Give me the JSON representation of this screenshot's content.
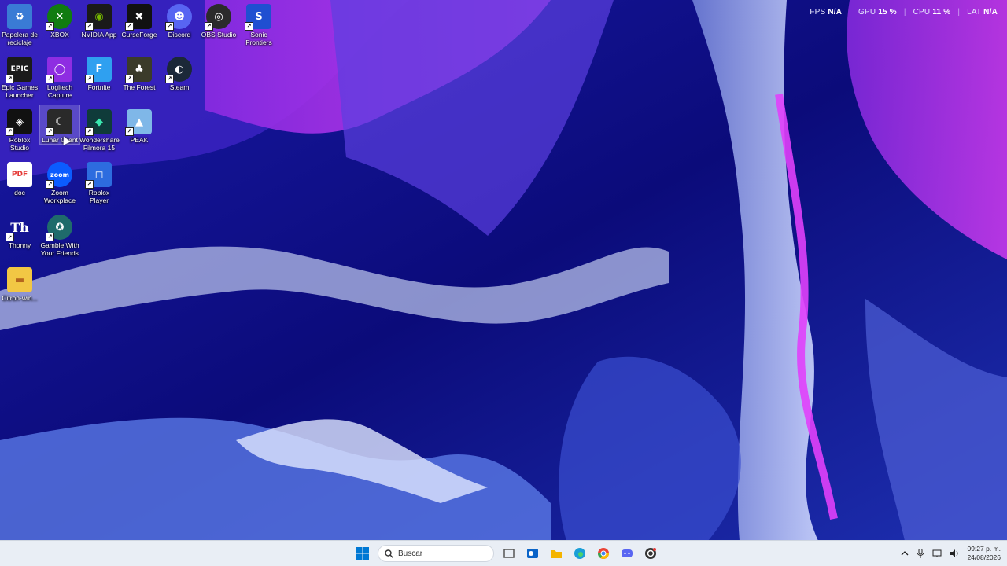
{
  "overlay": {
    "fps_label": "FPS",
    "fps_value": "N/A",
    "gpu_label": "GPU",
    "gpu_value": "15 %",
    "cpu_label": "CPU",
    "cpu_value": "11 %",
    "lat_label": "LAT",
    "lat_value": "N/A",
    "separator": "|"
  },
  "desktop": {
    "icons": [
      {
        "label": "Papelera de reciclaje",
        "icon": "recycle-bin-icon",
        "color": "#3a7bd5"
      },
      {
        "label": "XBOX",
        "icon": "xbox-icon",
        "color": "#107c10"
      },
      {
        "label": "NVIDIA App",
        "icon": "nvidia-icon",
        "color": "#1a1a1a"
      },
      {
        "label": "CurseForge",
        "icon": "curseforge-icon",
        "color": "#111111"
      },
      {
        "label": "Discord",
        "icon": "discord-icon",
        "color": "#5865f2"
      },
      {
        "label": "OBS Studio",
        "icon": "obs-icon",
        "color": "#2b2b2b"
      },
      {
        "label": "Sonic Frontiers",
        "icon": "sonic-icon",
        "color": "#1f4fd1"
      },
      {
        "label": "Epic Games Launcher",
        "icon": "epic-games-icon",
        "color": "#1b1b1b"
      },
      {
        "label": "Logitech Capture",
        "icon": "logitech-capture-icon",
        "color": "#8e2de2"
      },
      {
        "label": "Fortnite",
        "icon": "fortnite-icon",
        "color": "#2fa0f0"
      },
      {
        "label": "The Forest",
        "icon": "the-forest-icon",
        "color": "#3b3b2a"
      },
      {
        "label": "Steam",
        "icon": "steam-icon",
        "color": "#1b2838"
      },
      {
        "label": "Roblox Studio",
        "icon": "roblox-studio-icon",
        "color": "#111111"
      },
      {
        "label": "Lunar Client",
        "icon": "lunar-client-icon",
        "color": "#2a2a2a"
      },
      {
        "label": "Wondershare Filmora 15",
        "icon": "filmora-icon",
        "color": "#0f3b3a"
      },
      {
        "label": "PEAK",
        "icon": "peak-icon",
        "color": "#7fb7e8"
      },
      {
        "label": "doc",
        "icon": "pdf-icon",
        "color": "#e53935"
      },
      {
        "label": "Zoom Workplace",
        "icon": "zoom-icon",
        "color": "#0b5cff"
      },
      {
        "label": "Roblox Player",
        "icon": "roblox-player-icon",
        "color": "#2d6cdf"
      },
      {
        "label": "Thonny",
        "icon": "thonny-icon",
        "color": "#3a3a3a"
      },
      {
        "label": "Gamble With Your Friends",
        "icon": "gamble-icon",
        "color": "#1f6b6b"
      },
      {
        "label": "Citron-win...",
        "icon": "folder-icon",
        "color": "#f2c744"
      }
    ],
    "glyphs": {
      "xbox": "✕",
      "nvidia": "◉",
      "curseforge": "✖",
      "discord": "☻",
      "obs": "◎",
      "sonic": "S",
      "epic": "EPIC",
      "logitech": "◯",
      "fortnite": "F",
      "forest": "♣",
      "steam": "◐",
      "roblox_studio": "◈",
      "lunar": "☾",
      "filmora": "◆",
      "peak": "▲",
      "pdf": "PDF",
      "zoom": "zoom",
      "roblox_player": "◻",
      "thonny": "Th",
      "gamble": "✪",
      "folder": "▬",
      "recycle": "♻"
    }
  },
  "taskbar": {
    "search_placeholder": "Buscar",
    "pinned": [
      {
        "name": "task-view-icon",
        "color": "#555"
      },
      {
        "name": "outlook-icon",
        "color": "#0a64c8"
      },
      {
        "name": "file-explorer-icon",
        "color": "#f4b400"
      },
      {
        "name": "edge-icon",
        "color": "#1a9fd8"
      },
      {
        "name": "chrome-icon",
        "color": "#34a853"
      },
      {
        "name": "discord-taskbar-icon",
        "color": "#5865f2"
      },
      {
        "name": "obs-taskbar-icon",
        "color": "#333"
      }
    ],
    "clock_time": "09:27 p. m.",
    "clock_date": "24/08/2026"
  }
}
